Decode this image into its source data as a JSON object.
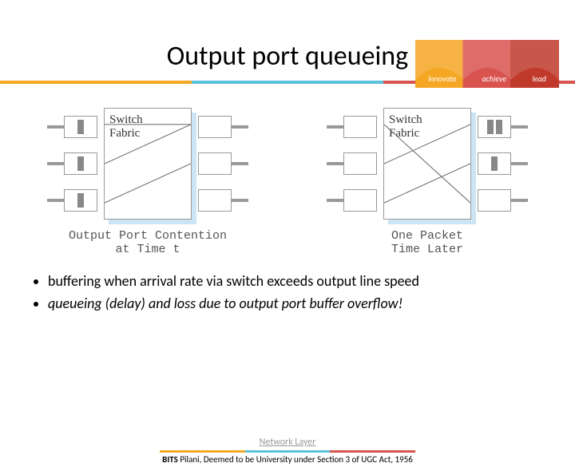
{
  "header": {
    "logo_labels": [
      "innovate",
      "achieve",
      "lead"
    ],
    "bits": "BITS Pilani"
  },
  "title": "Output port queueing",
  "diagram_left": {
    "fabric_label": "Switch\nFabric",
    "caption": "Output Port Contention\nat Time t"
  },
  "diagram_right": {
    "fabric_label": "Switch\nFabric",
    "caption": "One Packet\nTime Later"
  },
  "bullets": [
    "buffering when arrival rate via switch exceeds output line speed",
    "queueing (delay) and loss due to output port buffer overflow!"
  ],
  "footer": {
    "link": "Network Layer",
    "text": "BITS Pilani, Deemed to be University under Section 3 of UGC Act, 1956"
  }
}
